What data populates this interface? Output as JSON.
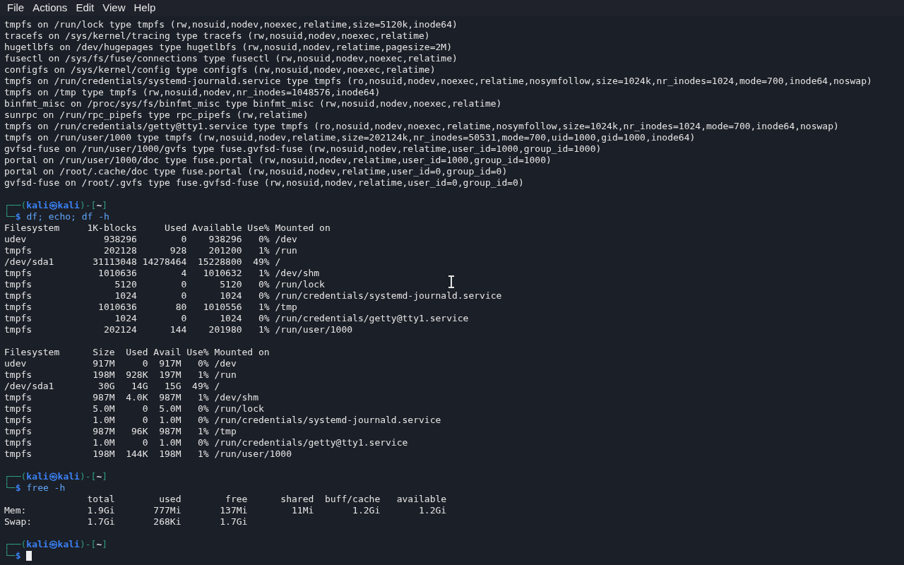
{
  "menu": [
    "File",
    "Actions",
    "Edit",
    "View",
    "Help"
  ],
  "terminal": {
    "lines": [
      {
        "kind": "output",
        "text": "tmpfs on /run/lock type tmpfs (rw,nosuid,nodev,noexec,relatime,size=5120k,inode64)"
      },
      {
        "kind": "output",
        "text": "tracefs on /sys/kernel/tracing type tracefs (rw,nosuid,nodev,noexec,relatime)"
      },
      {
        "kind": "output",
        "text": "hugetlbfs on /dev/hugepages type hugetlbfs (rw,nosuid,nodev,relatime,pagesize=2M)"
      },
      {
        "kind": "output",
        "text": "fusectl on /sys/fs/fuse/connections type fusectl (rw,nosuid,nodev,noexec,relatime)"
      },
      {
        "kind": "output",
        "text": "configfs on /sys/kernel/config type configfs (rw,nosuid,nodev,noexec,relatime)"
      },
      {
        "kind": "output",
        "text": "tmpfs on /run/credentials/systemd-journald.service type tmpfs (ro,nosuid,nodev,noexec,relatime,nosymfollow,size=1024k,nr_inodes=1024,mode=700,inode64,noswap)"
      },
      {
        "kind": "output",
        "text": "tmpfs on /tmp type tmpfs (rw,nosuid,nodev,nr_inodes=1048576,inode64)"
      },
      {
        "kind": "output",
        "text": "binfmt_misc on /proc/sys/fs/binfmt_misc type binfmt_misc (rw,nosuid,nodev,noexec,relatime)"
      },
      {
        "kind": "output",
        "text": "sunrpc on /run/rpc_pipefs type rpc_pipefs (rw,relatime)"
      },
      {
        "kind": "output",
        "text": "tmpfs on /run/credentials/getty@tty1.service type tmpfs (ro,nosuid,nodev,noexec,relatime,nosymfollow,size=1024k,nr_inodes=1024,mode=700,inode64,noswap)"
      },
      {
        "kind": "output",
        "text": "tmpfs on /run/user/1000 type tmpfs (rw,nosuid,nodev,relatime,size=202124k,nr_inodes=50531,mode=700,uid=1000,gid=1000,inode64)"
      },
      {
        "kind": "output",
        "text": "gvfsd-fuse on /run/user/1000/gvfs type fuse.gvfsd-fuse (rw,nosuid,nodev,relatime,user_id=1000,group_id=1000)"
      },
      {
        "kind": "output",
        "text": "portal on /run/user/1000/doc type fuse.portal (rw,nosuid,nodev,relatime,user_id=1000,group_id=1000)"
      },
      {
        "kind": "output",
        "text": "portal on /root/.cache/doc type fuse.portal (rw,nosuid,nodev,relatime,user_id=0,group_id=0)"
      },
      {
        "kind": "output",
        "text": "gvfsd-fuse on /root/.gvfs type fuse.gvfsd-fuse (rw,nosuid,nodev,relatime,user_id=0,group_id=0)"
      },
      {
        "kind": "blank"
      },
      {
        "kind": "prompt",
        "open": "┌──(",
        "user_host": "kali㉿kali",
        "mid": ")-[",
        "dir": "~",
        "close": "]"
      },
      {
        "kind": "command",
        "corner": "└─",
        "symbol": "$",
        "command": "df; echo; df -h"
      },
      {
        "kind": "output",
        "text": "Filesystem     1K-blocks     Used Available Use% Mounted on"
      },
      {
        "kind": "output",
        "text": "udev              938296        0    938296   0% /dev"
      },
      {
        "kind": "output",
        "text": "tmpfs             202128      928    201200   1% /run"
      },
      {
        "kind": "output",
        "text": "/dev/sda1       31113048 14278464  15228800  49% /"
      },
      {
        "kind": "output",
        "text": "tmpfs            1010636        4   1010632   1% /dev/shm"
      },
      {
        "kind": "output",
        "text": "tmpfs               5120        0      5120   0% /run/lock"
      },
      {
        "kind": "output",
        "text": "tmpfs               1024        0      1024   0% /run/credentials/systemd-journald.service"
      },
      {
        "kind": "output",
        "text": "tmpfs            1010636       80   1010556   1% /tmp"
      },
      {
        "kind": "output",
        "text": "tmpfs               1024        0      1024   0% /run/credentials/getty@tty1.service"
      },
      {
        "kind": "output",
        "text": "tmpfs             202124      144    201980   1% /run/user/1000"
      },
      {
        "kind": "blank"
      },
      {
        "kind": "output",
        "text": "Filesystem      Size  Used Avail Use% Mounted on"
      },
      {
        "kind": "output",
        "text": "udev            917M     0  917M   0% /dev"
      },
      {
        "kind": "output",
        "text": "tmpfs           198M  928K  197M   1% /run"
      },
      {
        "kind": "output",
        "text": "/dev/sda1        30G   14G   15G  49% /"
      },
      {
        "kind": "output",
        "text": "tmpfs           987M  4.0K  987M   1% /dev/shm"
      },
      {
        "kind": "output",
        "text": "tmpfs           5.0M     0  5.0M   0% /run/lock"
      },
      {
        "kind": "output",
        "text": "tmpfs           1.0M     0  1.0M   0% /run/credentials/systemd-journald.service"
      },
      {
        "kind": "output",
        "text": "tmpfs           987M   96K  987M   1% /tmp"
      },
      {
        "kind": "output",
        "text": "tmpfs           1.0M     0  1.0M   0% /run/credentials/getty@tty1.service"
      },
      {
        "kind": "output",
        "text": "tmpfs           198M  144K  198M   1% /run/user/1000"
      },
      {
        "kind": "blank"
      },
      {
        "kind": "prompt",
        "open": "┌──(",
        "user_host": "kali㉿kali",
        "mid": ")-[",
        "dir": "~",
        "close": "]"
      },
      {
        "kind": "command",
        "corner": "└─",
        "symbol": "$",
        "command": "free -h"
      },
      {
        "kind": "output",
        "text": "               total        used        free      shared  buff/cache   available"
      },
      {
        "kind": "output",
        "text": "Mem:           1.9Gi       777Mi       137Mi        11Mi       1.2Gi       1.2Gi"
      },
      {
        "kind": "output",
        "text": "Swap:          1.7Gi       268Ki       1.7Gi"
      },
      {
        "kind": "blank"
      },
      {
        "kind": "prompt",
        "open": "┌──(",
        "user_host": "kali㉿kali",
        "mid": ")-[",
        "dir": "~",
        "close": "]"
      },
      {
        "kind": "input",
        "corner": "└─",
        "symbol": "$"
      }
    ]
  }
}
